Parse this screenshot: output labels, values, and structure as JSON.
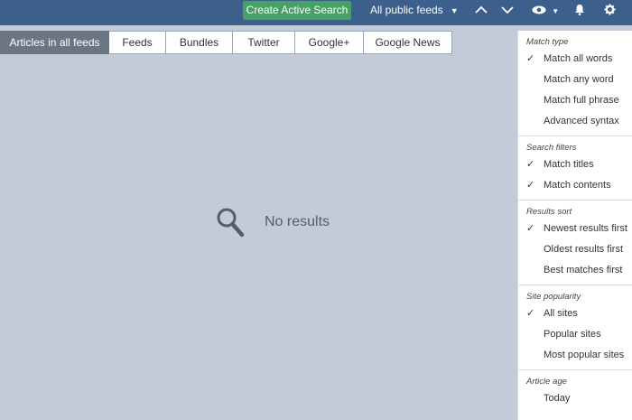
{
  "topbar": {
    "create_label": "Create Active Search",
    "feeds_label": "All public feeds",
    "icons": [
      "chevron-up-icon",
      "chevron-down-icon",
      "eye-icon",
      "bell-icon",
      "gear-icon"
    ],
    "colors": {
      "bar": "#3d5f8c",
      "create": "#45a165"
    }
  },
  "tabs": [
    {
      "label": "Articles in all feeds",
      "active": true
    },
    {
      "label": "Feeds"
    },
    {
      "label": "Bundles"
    },
    {
      "label": "Twitter"
    },
    {
      "label": "Google+"
    },
    {
      "label": "Google News"
    }
  ],
  "empty": {
    "message": "No results",
    "icon": "search-icon"
  },
  "panel": {
    "sections": [
      {
        "title": "Match type",
        "options": [
          {
            "label": "Match all words",
            "checked": true
          },
          {
            "label": "Match any word",
            "checked": false
          },
          {
            "label": "Match full phrase",
            "checked": false
          },
          {
            "label": "Advanced syntax",
            "checked": false
          }
        ]
      },
      {
        "title": "Search filters",
        "options": [
          {
            "label": "Match titles",
            "checked": true
          },
          {
            "label": "Match contents",
            "checked": true
          }
        ]
      },
      {
        "title": "Results sort",
        "options": [
          {
            "label": "Newest results first",
            "checked": true
          },
          {
            "label": "Oldest results first",
            "checked": false
          },
          {
            "label": "Best matches first",
            "checked": false
          }
        ]
      },
      {
        "title": "Site popularity",
        "options": [
          {
            "label": "All sites",
            "checked": true
          },
          {
            "label": "Popular sites",
            "checked": false
          },
          {
            "label": "Most popular sites",
            "checked": false
          }
        ]
      },
      {
        "title": "Article age",
        "options": [
          {
            "label": "Today",
            "checked": false
          }
        ]
      }
    ]
  }
}
